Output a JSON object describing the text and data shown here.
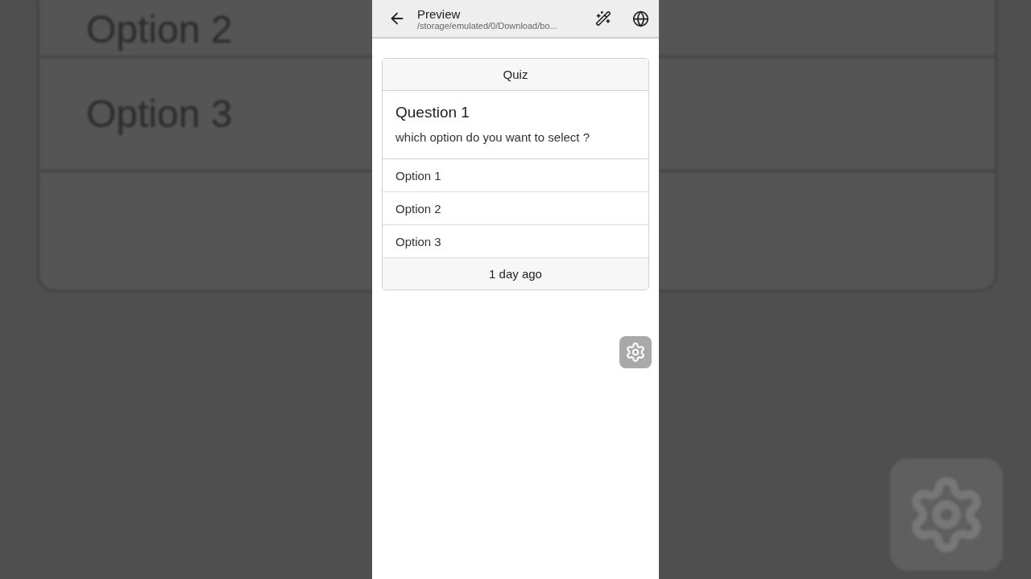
{
  "backdrop": {
    "rows": [
      "Option 2",
      "Option 3"
    ]
  },
  "app_bar": {
    "title": "Preview",
    "subtitle": "/storage/emulated/0/Download/bo..."
  },
  "quiz": {
    "header": "Quiz",
    "question_title": "Question 1",
    "question_text": "which option do you want to select ?",
    "options": [
      "Option 1",
      "Option 2",
      "Option 3"
    ],
    "footer": "1 day ago"
  }
}
